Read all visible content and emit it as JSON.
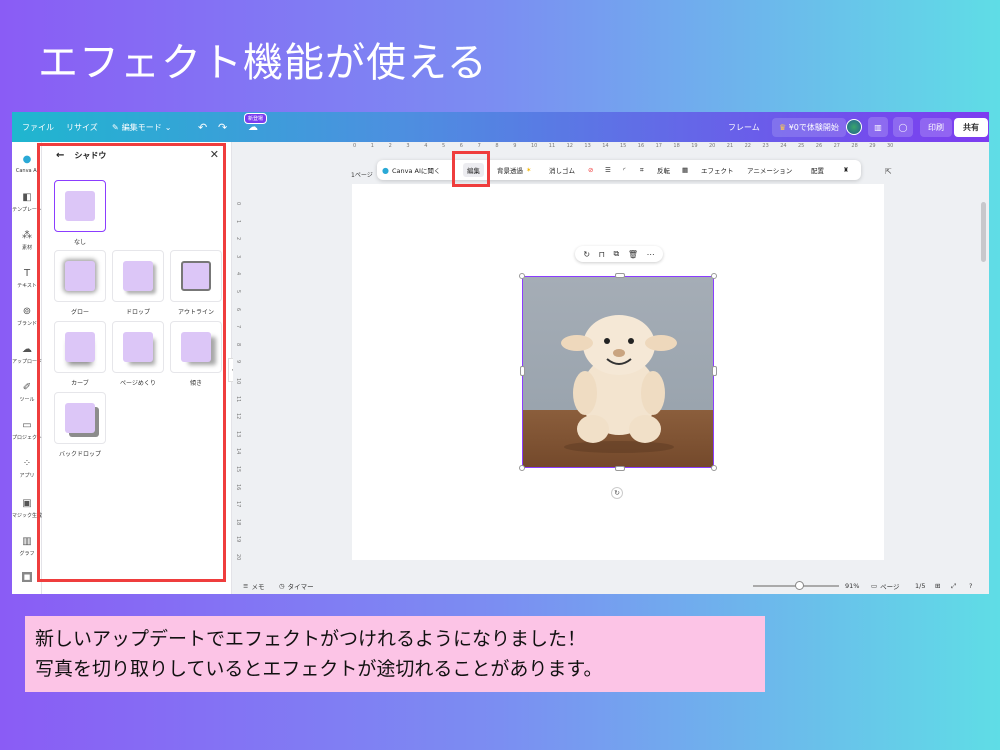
{
  "headline": "エフェクト機能が使える",
  "topbar": {
    "file": "ファイル",
    "resize": "リサイズ",
    "edit_mode": "編集モード",
    "new_badge": "新登場",
    "frame": "フレーム",
    "trial": "¥0で体験開始",
    "print": "印刷",
    "share": "共有"
  },
  "rail": [
    {
      "label": "Canva AI",
      "icon": "canva-ai-icon"
    },
    {
      "label": "テンプレート",
      "icon": "template-icon"
    },
    {
      "label": "素材",
      "icon": "elements-icon"
    },
    {
      "label": "テキスト",
      "icon": "text-icon"
    },
    {
      "label": "ブランド",
      "icon": "brand-icon"
    },
    {
      "label": "アップロード",
      "icon": "upload-icon"
    },
    {
      "label": "ツール",
      "icon": "tool-icon"
    },
    {
      "label": "プロジェクト",
      "icon": "project-icon"
    },
    {
      "label": "アプリ",
      "icon": "apps-icon"
    },
    {
      "label": "マジック生成",
      "icon": "magic-icon"
    },
    {
      "label": "グラフ",
      "icon": "chart-icon"
    }
  ],
  "panel": {
    "title": "シャドウ",
    "options": [
      "なし",
      "グロー",
      "ドロップ",
      "アウトライン",
      "カーブ",
      "ページめくり",
      "傾き",
      "バックドロップ"
    ]
  },
  "toolbar": {
    "page_label": "1ページ",
    "canva_ai": "Canva AIに聞く",
    "edit": "編集",
    "bg_remove": "背景透過",
    "eraser": "消しゴム",
    "flip": "反転",
    "effect": "エフェクト",
    "animation": "アニメーション",
    "arrange": "配置"
  },
  "ruler_top": [
    "0",
    "1",
    "2",
    "3",
    "4",
    "5",
    "6",
    "7",
    "8",
    "9",
    "10",
    "11",
    "12",
    "13",
    "14",
    "15",
    "16",
    "17",
    "18",
    "19",
    "20",
    "21",
    "22",
    "23",
    "24",
    "25",
    "26",
    "27",
    "28",
    "29",
    "30"
  ],
  "ruler_left": [
    "0",
    "1",
    "2",
    "3",
    "4",
    "5",
    "6",
    "7",
    "8",
    "9",
    "10",
    "11",
    "12",
    "13",
    "14",
    "15",
    "16",
    "17",
    "18",
    "19",
    "20"
  ],
  "bottombar": {
    "memo": "メモ",
    "timer": "タイマー",
    "zoom": "91%",
    "pages": "ページ",
    "page_count": "1/5"
  },
  "caption": {
    "line1": "新しいアップデートでエフェクトがつけれるようになりました！",
    "line2": "写真を切り取りしているとエフェクトが途切れることがあります。"
  },
  "colors": {
    "accent": "#8b3dff",
    "highlight": "#ef3d3d",
    "caption_bg": "#fcc4e6"
  }
}
